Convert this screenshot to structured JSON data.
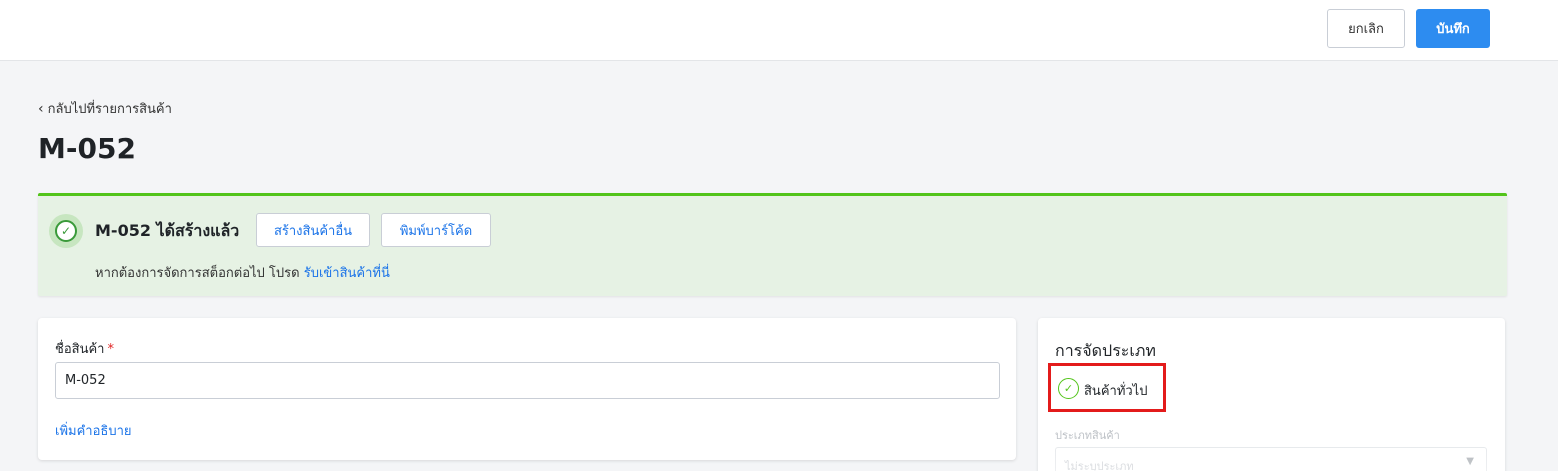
{
  "header": {
    "cancel_label": "ยกเลิก",
    "save_label": "บันทึก"
  },
  "back_link": "กลับไปที่รายการสินค้า",
  "page_title": "M-052",
  "alert": {
    "title": "M-052 ได้สร้างแล้ว",
    "create_another_label": "สร้างสินค้าอื่น",
    "print_barcode_label": "พิมพ์บาร์โค้ด",
    "message_prefix": "หากต้องการจัดการสต็อกต่อไป โปรด",
    "message_link": "รับเข้าสินค้าที่นี่"
  },
  "product_form": {
    "name_label": "ชื่อสินค้า",
    "required_mark": "*",
    "name_value": "M-052",
    "add_description_label": "เพิ่มคำอธิบาย"
  },
  "classification": {
    "title": "การจัดประเภท",
    "selected_option": "สินค้าทั่วไป",
    "product_type_label": "ประเภทสินค้า",
    "product_type_value": "ไม่ระบุประเภท"
  },
  "colors": {
    "primary": "#2d8cf0",
    "success": "#52c41a",
    "alert_bg": "#e6f2e4",
    "highlight_box": "#e31b1b",
    "link": "#1a73e8"
  },
  "icons": {
    "back": "chevron-left-icon",
    "success": "check-circle-icon",
    "classify_selected": "check-circle-outline-icon",
    "select_caret": "chevron-down-icon"
  }
}
